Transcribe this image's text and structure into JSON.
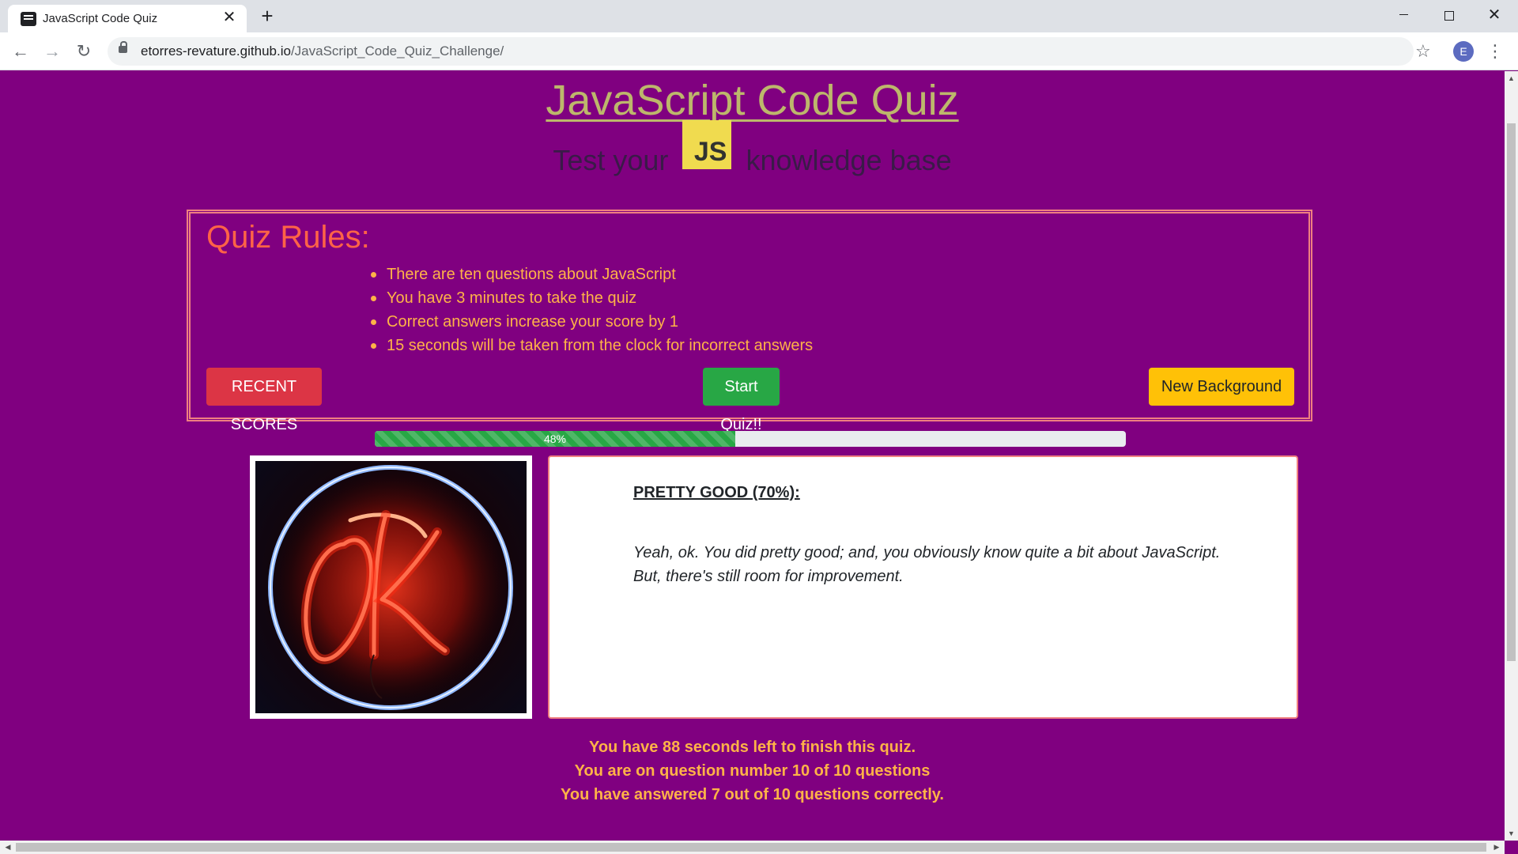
{
  "browser": {
    "tab_title": "JavaScript Code Quiz",
    "new_tab": "+",
    "close_tab": "✕",
    "url_domain": "etorres-revature.github.io",
    "url_path": "/JavaScript_Code_Quiz_Challenge/",
    "profile_initial": "E",
    "window_close": "✕"
  },
  "header": {
    "title": "JavaScript Code Quiz",
    "subtitle_before": "Test your",
    "logo_text": "JS",
    "subtitle_after": "knowledge base"
  },
  "rules": {
    "title": "Quiz Rules:",
    "items": [
      "There are ten questions about JavaScript",
      "You have 3 minutes to take the quiz",
      "Correct answers increase your score by 1",
      "15 seconds will be taken from the clock for incorrect answers"
    ],
    "buttons": {
      "recent_scores": "RECENT SCORES",
      "start_quiz": "Start Quiz!!",
      "new_background": "New Background"
    }
  },
  "progress": {
    "label": "48%",
    "value_percent": 48
  },
  "result": {
    "image_text": "OK",
    "heading": "PRETTY GOOD (70%):",
    "text": "Yeah, ok. You did pretty good; and, you obviously know quite a bit about JavaScript. But, there's still room for improvement."
  },
  "status": {
    "time_left": "You have 88 seconds left to finish this quiz.",
    "question_number": "You are on question number 10 of 10 questions",
    "correct_count": "You have answered 7 out of 10 questions correctly."
  },
  "colors": {
    "page_background": "#800080",
    "title": "#bdb76b",
    "rules_title": "#ff6347",
    "rules_text": "#ffb347",
    "recent_button": "#dc3545",
    "start_button": "#28a745",
    "background_button": "#ffc107"
  }
}
